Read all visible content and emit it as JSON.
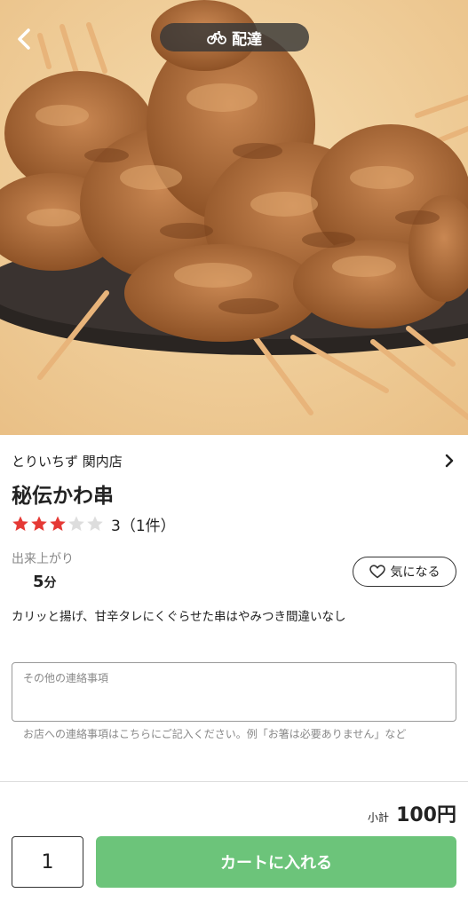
{
  "header": {
    "delivery_label": "配達"
  },
  "shop": {
    "name": "とりいちず 関内店"
  },
  "item": {
    "title": "秘伝かわ串",
    "rating": 3,
    "rating_max": 5,
    "rating_text": "3（1件）",
    "finish_label": "出来上がり",
    "finish_value": "5",
    "finish_unit": "分",
    "favorite_label": "気になる",
    "description": "カリッと揚げ、甘辛タレにくぐらせた串はやみつき間違いなし"
  },
  "note": {
    "placeholder": "その他の連絡事項",
    "hint": "お店への連絡事項はこちらにご記入ください。例「お箸は必要ありません」など"
  },
  "footer": {
    "subtotal_label": "小計",
    "subtotal_amount": "100円",
    "quantity": "1",
    "cart_button_label": "カートに入れる"
  },
  "colors": {
    "star_filled": "#e53935",
    "star_empty": "#dddddd",
    "cart_button": "#6cc47a"
  }
}
